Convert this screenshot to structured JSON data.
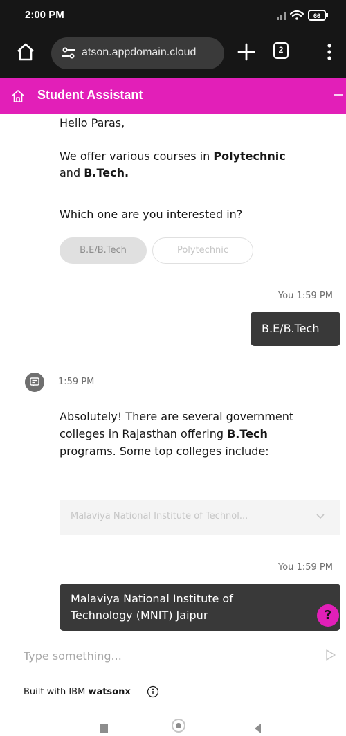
{
  "status_bar": {
    "time": "2:00 PM",
    "battery": "66"
  },
  "browser": {
    "url": "atson.appdomain.cloud",
    "tab_count": "2"
  },
  "chat_header": {
    "title": "Student Assistant"
  },
  "messages": {
    "greeting": "Hello Paras,",
    "offer_prefix": "We offer various courses in ",
    "offer_bold_1": "Polytechnic",
    "offer_and": "and ",
    "offer_bold_2": "B.Tech.",
    "question": "Which one are you interested in?",
    "chips": [
      "B.E/B.Tech",
      "Polytechnic"
    ],
    "user_time_1": "You 1:59 PM",
    "user_reply_1": "B.E/B.Tech",
    "bot_time": "1:59 PM",
    "bot_line_1": "Absolutely! There are several government",
    "bot_line_2_prefix": "colleges in Rajasthan offering ",
    "bot_line_2_bold": "B.Tech",
    "bot_line_3": "programs. Some top colleges include:",
    "dropdown_value": "Malaviya National Institute of Technol...",
    "user_time_2": "You 1:59 PM",
    "user_reply_2_line_1": "Malaviya National Institute of",
    "user_reply_2_line_2": "Technology (MNIT) Jaipur",
    "help_label": "?"
  },
  "composer": {
    "placeholder": "Type something...",
    "built_prefix": "Built with IBM ",
    "built_brand": "watsonx"
  },
  "colors": {
    "accent": "#e21fb8",
    "user_bubble": "#393939",
    "status_bar": "#161616"
  },
  "icons": [
    "home-icon",
    "site-settings-icon",
    "plus-icon",
    "tabs-icon",
    "more-vertical-icon",
    "chat-home-icon",
    "minimize-icon",
    "bot-avatar-icon",
    "chevron-down-icon",
    "help-icon",
    "send-icon",
    "info-icon"
  ]
}
